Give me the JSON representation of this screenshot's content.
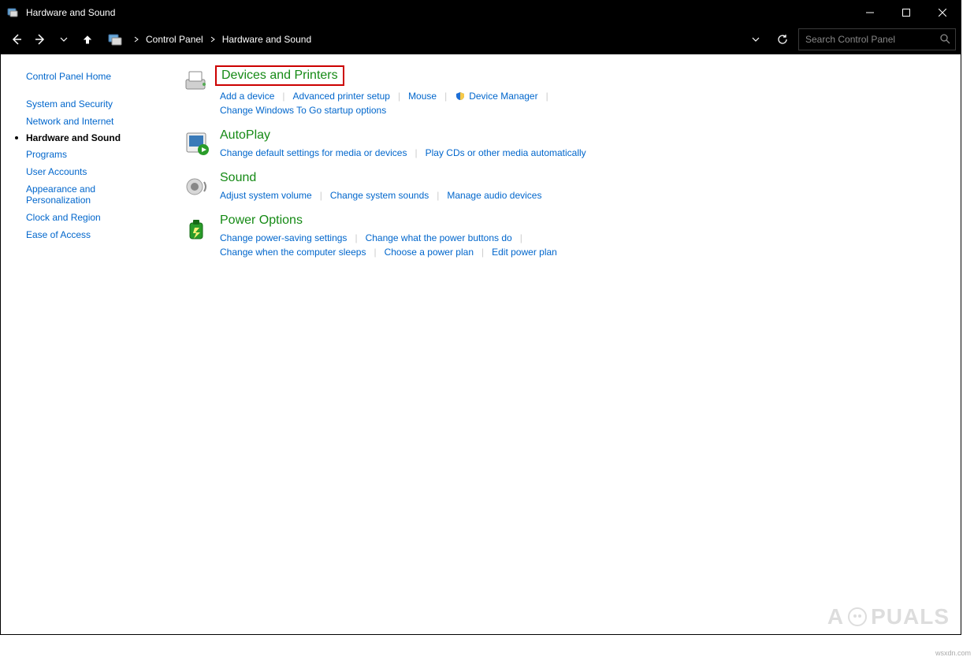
{
  "window": {
    "title": "Hardware and Sound"
  },
  "breadcrumb": {
    "root": "Control Panel",
    "current": "Hardware and Sound"
  },
  "search": {
    "placeholder": "Search Control Panel"
  },
  "sidebar": {
    "home": "Control Panel Home",
    "items": [
      "System and Security",
      "Network and Internet",
      "Hardware and Sound",
      "Programs",
      "User Accounts",
      "Appearance and Personalization",
      "Clock and Region",
      "Ease of Access"
    ],
    "active_index": 2
  },
  "categories": {
    "devices": {
      "title": "Devices and Printers",
      "tasks": [
        "Add a device",
        "Advanced printer setup",
        "Mouse",
        "Device Manager",
        "Change Windows To Go startup options"
      ]
    },
    "autoplay": {
      "title": "AutoPlay",
      "tasks": [
        "Change default settings for media or devices",
        "Play CDs or other media automatically"
      ]
    },
    "sound": {
      "title": "Sound",
      "tasks": [
        "Adjust system volume",
        "Change system sounds",
        "Manage audio devices"
      ]
    },
    "power": {
      "title": "Power Options",
      "tasks": [
        "Change power-saving settings",
        "Change what the power buttons do",
        "Change when the computer sleeps",
        "Choose a power plan",
        "Edit power plan"
      ]
    }
  },
  "watermark": {
    "brand_left": "A",
    "brand_right": "PUALS"
  },
  "source": "wsxdn.com"
}
